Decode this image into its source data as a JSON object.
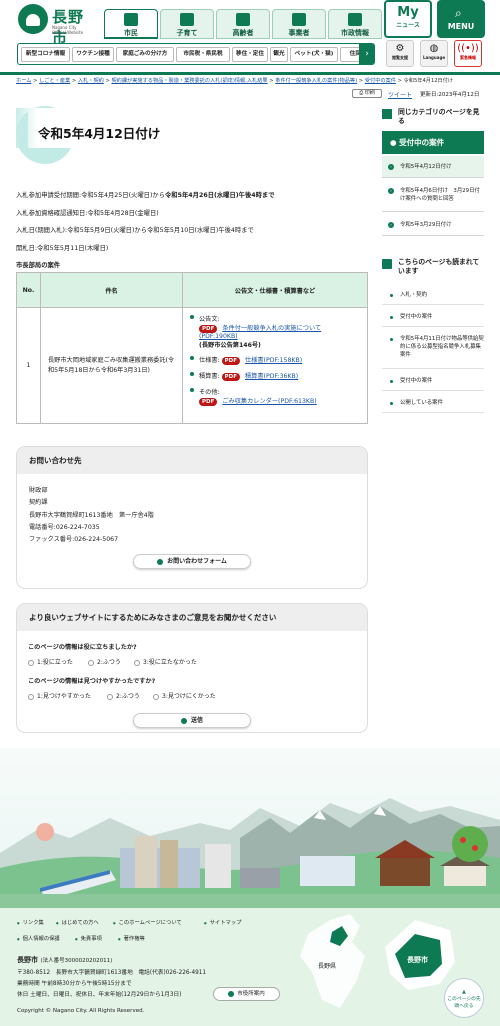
{
  "header": {
    "logo_main": "長野市",
    "logo_sub1": "Nagano City",
    "logo_sub2": "Official Website",
    "gnav": [
      {
        "label": "市民"
      },
      {
        "label": "子育て"
      },
      {
        "label": "高齢者"
      },
      {
        "label": "事業者"
      },
      {
        "label": "市政情報"
      }
    ],
    "my_big": "My",
    "my_small": "ニュース",
    "menu_label": "MENU",
    "subnav": [
      "新型コロナ情報",
      "ワクチン接種",
      "家庭ごみの分け方",
      "市民税・県民税",
      "移住・定住",
      "観光",
      "ペット(犬・猫)",
      "住民票"
    ],
    "util": [
      {
        "label": "閲覧支援",
        "icon": "gear-icon"
      },
      {
        "label": "Language",
        "icon": "globe-icon"
      },
      {
        "label": "緊急情報",
        "icon": "alert-icon"
      }
    ]
  },
  "breadcrumb": {
    "items": [
      "ホーム",
      "しごと・産業",
      "入札・契約",
      "契約課が実施する物品・製造・業務委託の入札(調達)情報,入札結果",
      "条件付一般競争入札の案件(物品等)",
      "受付中の案件"
    ],
    "current": "令和5年4月12日付け"
  },
  "toolbar": {
    "print": "印刷",
    "tweet": "ツイート",
    "updated": "更新日:2023年4月12日"
  },
  "page": {
    "title": "令和5年4月12日付け",
    "lines": [
      {
        "pre": "入札参加申請受付期間:令和5年4月25日(火曜日)から",
        "bold": "令和5年4月26日(水曜日)午後4時まで"
      },
      {
        "pre": "入札参加資格確認通知日:令和5年4月28日(金曜日)",
        "bold": ""
      },
      {
        "pre": "入札日(期間入札):令和5年5月9日(火曜日)から令和5年5月10日(水曜日)午後4時まで",
        "bold": ""
      },
      {
        "pre": "開札日:令和5年5月11日(木曜日)",
        "bold": ""
      }
    ],
    "section_heading": "市長部局の案件",
    "table": {
      "headers": [
        "No.",
        "件名",
        "公告文・仕様書・積算書など"
      ],
      "rows": [
        {
          "no": "1",
          "subject": "長野市大岡地域家庭ごみ収集運搬業務委託(令和5年5月18日から令和6年3月31日)",
          "docs": {
            "notice_label": "公告文:",
            "notice_link": "条件付一般競争入札の実施について(PDF:190KB)",
            "notice_note": "(長野市公告第146号)",
            "spec_label": "仕様書:",
            "spec_link": "仕様書(PDF:158KB)",
            "estimate_label": "積算書:",
            "estimate_link": "積算書(PDF:36KB)",
            "other_label": "その他:",
            "other_link": "ごみ収集カレンダー(PDF:613KB)",
            "pdf_badge": "PDF"
          }
        }
      ]
    }
  },
  "contact": {
    "heading": "お問い合わせ先",
    "lines": [
      "財政部",
      "契約課",
      "長野市大字鶴賀緑町1613番地　第一庁舎4階",
      "電話番号:026-224-7035",
      "ファックス番号:026-224-5067"
    ],
    "form_button": "お問い合わせフォーム"
  },
  "survey": {
    "heading": "より良いウェブサイトにするためにみなさまのご意見をお聞かせください",
    "q1": "このページの情報は役に立ちましたか?",
    "q1_options": [
      "1:役に立った",
      "2:ふつう",
      "3:役に立たなかった"
    ],
    "q2": "このページの情報は見つけやすかったですか?",
    "q2_options": [
      "1:見つけやすかった",
      "2:ふつう",
      "3:見つけにくかった"
    ],
    "submit": "送信"
  },
  "sidebar": {
    "cat_heading": "同じカテゴリのページを見る",
    "active_heading": "受付中の案件",
    "cat_items": [
      "令和5年4月12日付け",
      "令和5年4月6日付け　3月29日付け案件への質問と回答",
      "令和5年3月29日付け"
    ],
    "read_heading": "こちらのページも読まれています",
    "read_items": [
      "入札・契約",
      "受付中の案件",
      "令和5年4月11日付け物品等供給契約に係る公募型指名競争入札募集案件",
      "受付中の案件",
      "公開している案件"
    ]
  },
  "footer": {
    "links_row1": [
      "リンク集",
      "はじめての方へ",
      "このホームページについて",
      "サイトマップ"
    ],
    "links_row2": [
      "個人情報の保護",
      "免責事項",
      "著作権等"
    ],
    "name": "長野市",
    "corp_no": "(法人番号3000020202011)",
    "address": "〒380-8512　長野市大字鶴賀緑町1613番地　電話(代表)026-226-4911",
    "hours1": "業務時間 午前8時30分から午後5時15分まで",
    "hours2": "休日 土曜日、日曜日、祝休日、年末年始(12月29日から1月3日)",
    "office_button": "市役所案内",
    "map_label_pref": "長野県",
    "map_label_city": "長野市",
    "top_button": "このページの先頭へ戻る",
    "copyright": "Copyright © Nagano City. All Rights Reserved."
  },
  "colors": {
    "brand_green": "#0e7a53",
    "pdf_red": "#c01515",
    "link_blue": "#1a55a8"
  }
}
